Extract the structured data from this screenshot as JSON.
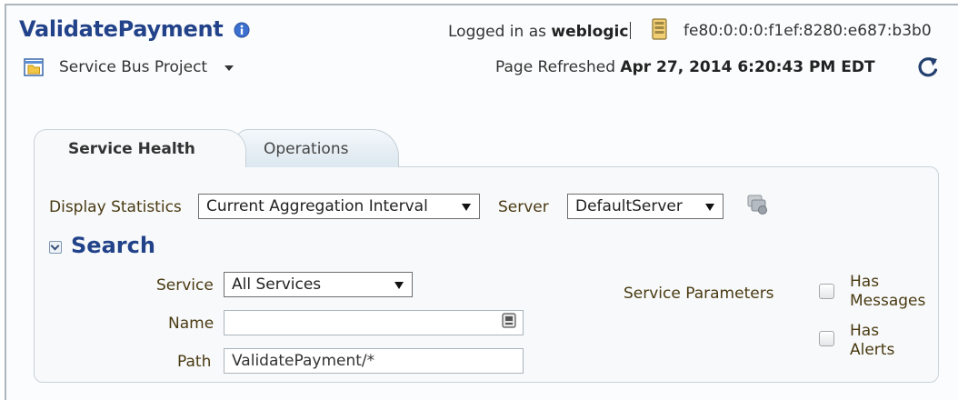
{
  "header": {
    "title": "ValidatePayment",
    "project_label": "Service Bus Project",
    "logged_in_prefix": "Logged in as",
    "username": "weblogic",
    "server_address": "fe80:0:0:0:f1ef:8280:e687:b3b0",
    "refreshed_prefix": "Page Refreshed",
    "refreshed_time": "Apr 27, 2014 6:20:43 PM EDT"
  },
  "tabs": [
    {
      "label": "Service Health",
      "selected": true
    },
    {
      "label": "Operations",
      "selected": false
    }
  ],
  "statistics": {
    "display_label": "Display Statistics",
    "display_value": "Current Aggregation Interval",
    "server_label": "Server",
    "server_value": "DefaultServer"
  },
  "search": {
    "title": "Search",
    "service_label": "Service",
    "service_value": "All Services",
    "name_label": "Name",
    "name_value": "",
    "path_label": "Path",
    "path_value": "ValidatePayment/*",
    "params_label": "Service Parameters",
    "has_messages_line1": "Has",
    "has_messages_line2": "Messages",
    "has_messages_checked": false,
    "has_alerts_line1": "Has",
    "has_alerts_line2": "Alerts",
    "has_alerts_checked": false
  },
  "icons": {
    "info": "info-icon",
    "project": "folder-icon",
    "server": "server-icon",
    "refresh": "refresh-icon",
    "go": "go-icon",
    "picker": "picker-icon"
  },
  "colors": {
    "title": "#22428a",
    "label": "#4a3a12",
    "panel": "#f7f9fa",
    "border": "#c9d3da"
  }
}
